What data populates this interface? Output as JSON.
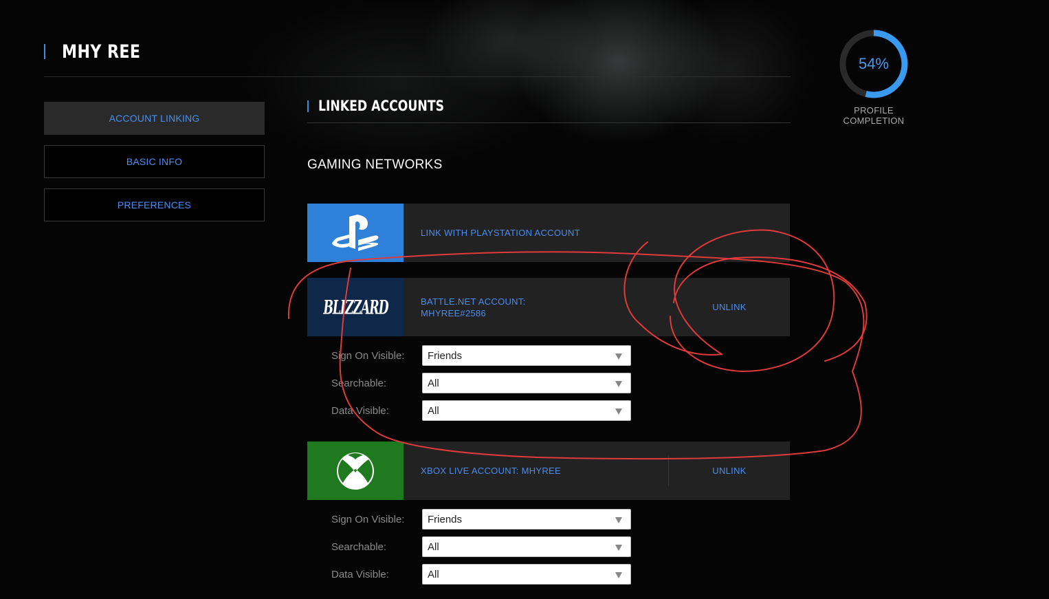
{
  "user": {
    "name": "MHY REE"
  },
  "sidebar": {
    "items": [
      {
        "label": "ACCOUNT LINKING",
        "active": true
      },
      {
        "label": "BASIC INFO",
        "active": false
      },
      {
        "label": "PREFERENCES",
        "active": false
      }
    ]
  },
  "section": {
    "title": "LINKED ACCOUNTS",
    "subtitle": "GAMING NETWORKS"
  },
  "profile": {
    "completion_value": 0.54,
    "completion_text": "54%",
    "label_line1": "PROFILE",
    "label_line2": "COMPLETION"
  },
  "networks": {
    "playstation": {
      "label": "LINK WITH PLAYSTATION ACCOUNT",
      "icon": "playstation-icon"
    },
    "battlenet": {
      "label_line1": "BATTLE.NET ACCOUNT:",
      "label_line2": "MHYREE#2586",
      "unlink": "UNLINK",
      "logo_text": "BLIZZARD",
      "settings": [
        {
          "label": "Sign On Visible:",
          "value": "Friends"
        },
        {
          "label": "Searchable:",
          "value": "All"
        },
        {
          "label": "Data Visible:",
          "value": "All"
        }
      ]
    },
    "xbox": {
      "label": "XBOX LIVE ACCOUNT: MHYREE",
      "unlink": "UNLINK",
      "icon": "xbox-icon",
      "settings": [
        {
          "label": "Sign On Visible:",
          "value": "Friends"
        },
        {
          "label": "Searchable:",
          "value": "All"
        },
        {
          "label": "Data Visible:",
          "value": "All"
        }
      ]
    }
  },
  "colors": {
    "accent": "#3a8ee6",
    "link": "#4a8ef0",
    "playstation": "#2f80d9",
    "battlenet": "#0f2748",
    "xbox": "#1f7a1f",
    "annotation": "#e03a3a"
  }
}
